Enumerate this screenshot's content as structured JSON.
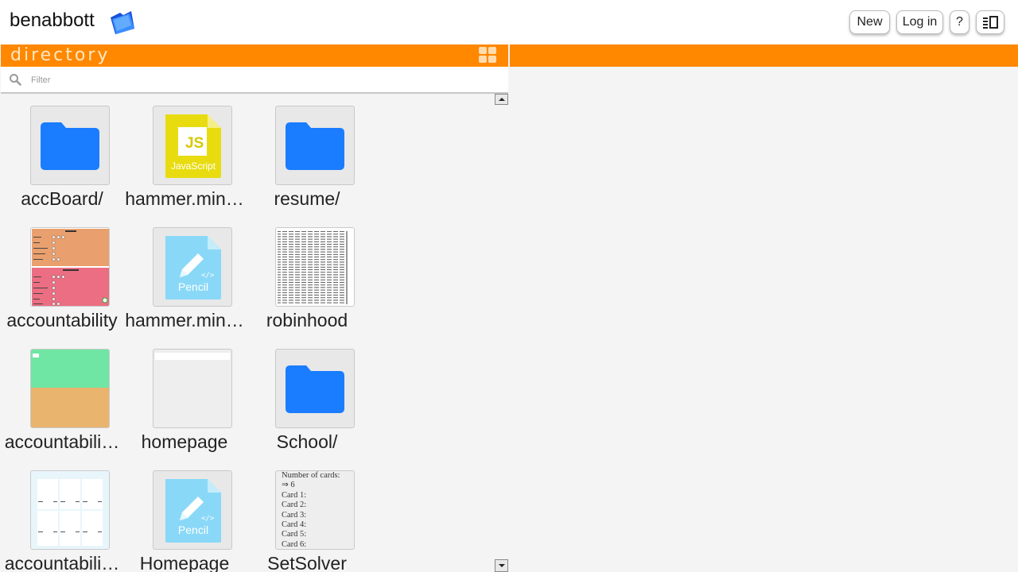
{
  "header": {
    "brand": "benabbott",
    "buttons": {
      "new": "New",
      "login": "Log in",
      "help": "?"
    }
  },
  "directory": {
    "title": "directory",
    "filter_placeholder": "Filter",
    "files": [
      {
        "name": "accBoard/",
        "kind": "folder"
      },
      {
        "name": "hammer.min…",
        "kind": "javascript",
        "badge": "JS",
        "label": "JavaScript"
      },
      {
        "name": "resume/",
        "kind": "folder"
      },
      {
        "name": "accountability",
        "kind": "preview-form"
      },
      {
        "name": "hammer.min…",
        "kind": "pencil",
        "label": "Pencil"
      },
      {
        "name": "robinhood",
        "kind": "preview-table"
      },
      {
        "name": "accountabili…",
        "kind": "preview-colors"
      },
      {
        "name": "homepage",
        "kind": "preview-blank"
      },
      {
        "name": "School/",
        "kind": "folder"
      },
      {
        "name": "accountabili…",
        "kind": "preview-grid"
      },
      {
        "name": "Homepage",
        "kind": "pencil",
        "label": "Pencil"
      },
      {
        "name": "SetSolver",
        "kind": "preview-text",
        "preview_text": "Number of cards:\n⇒ 6\nCard 1:\nCard 2:\nCard 3:\nCard 4:\nCard 5:\nCard 6:"
      }
    ]
  },
  "colors": {
    "accent": "#ff8800",
    "folder": "#1a7cff",
    "js": "#e8dc10",
    "pencil": "#8ad8f7"
  },
  "icons": [
    "folder-icon",
    "js-file-icon",
    "pencil-file-icon",
    "search-icon",
    "grid-view-icon",
    "panel-toggle-icon"
  ]
}
